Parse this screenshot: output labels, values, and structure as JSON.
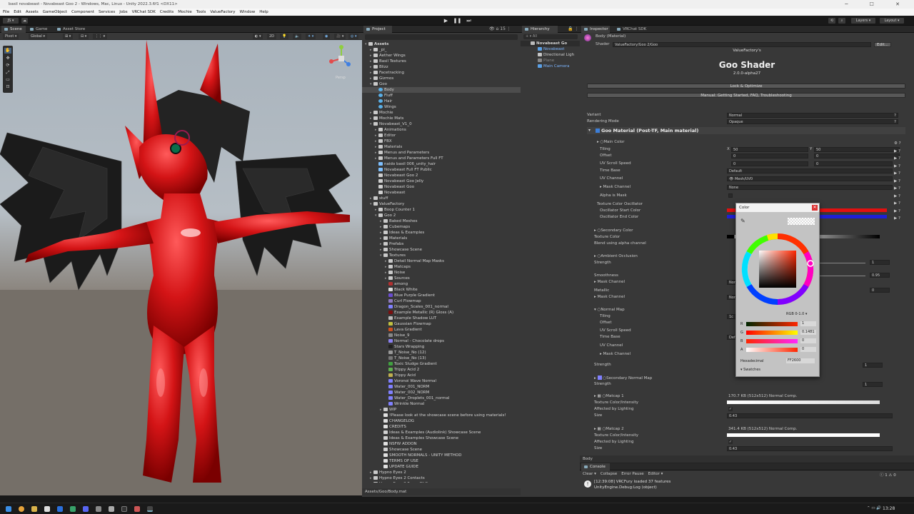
{
  "window": {
    "title": "basil novabeast - Novabeast Goo 2 - Windows, Mac, Linux - Unity 2022.3.6f1 <DX11>",
    "controls": "─ ☐ ✕"
  },
  "menu": [
    "File",
    "Edit",
    "Assets",
    "GameObject",
    "Component",
    "Services",
    "Jobs",
    "VRChat SDK",
    "Credits",
    "Mochie",
    "Tools",
    "ValueFactory",
    "Window",
    "Help"
  ],
  "toolbar": {
    "account": "JS",
    "layers": "Layers",
    "layout": "Layout"
  },
  "scene": {
    "tabs": [
      "Scene",
      "Game",
      "Asset Store"
    ],
    "pivot": "Pivot",
    "global": "Global",
    "mode2d": "2D",
    "gizmo_label": "Persp"
  },
  "project": {
    "tab": "Project",
    "root": "Assets",
    "search_count": "15",
    "footer": "Assets/Goo/Body.mat",
    "items": [
      {
        "t": "_pi_",
        "d": 1,
        "k": "folder"
      },
      {
        "t": "Aether Wings",
        "d": 1,
        "k": "folder"
      },
      {
        "t": "Basil Textures",
        "d": 1,
        "k": "folder"
      },
      {
        "t": "Blizz",
        "d": 1,
        "k": "folder"
      },
      {
        "t": "Facetracking",
        "d": 1,
        "k": "folder"
      },
      {
        "t": "Gizmos",
        "d": 1,
        "k": "folder"
      },
      {
        "t": "Goo",
        "d": 1,
        "k": "folder",
        "open": true
      },
      {
        "t": "Body",
        "d": 2,
        "k": "mat",
        "sel": true
      },
      {
        "t": "Fluff",
        "d": 2,
        "k": "mat"
      },
      {
        "t": "Hair",
        "d": 2,
        "k": "mat"
      },
      {
        "t": "Wings",
        "d": 2,
        "k": "mat"
      },
      {
        "t": "Mochie",
        "d": 1,
        "k": "folder"
      },
      {
        "t": "Mochie Mats",
        "d": 1,
        "k": "folder"
      },
      {
        "t": "Novabeast_V1_0",
        "d": 1,
        "k": "folder",
        "open": true
      },
      {
        "t": "Animations",
        "d": 2,
        "k": "folder"
      },
      {
        "t": "Editor",
        "d": 2,
        "k": "folder"
      },
      {
        "t": "FBX",
        "d": 2,
        "k": "folder"
      },
      {
        "t": "Materials",
        "d": 2,
        "k": "folder"
      },
      {
        "t": "Menus and Parameters",
        "d": 2,
        "k": "folder"
      },
      {
        "t": "Menus and Parameters Full FT",
        "d": 2,
        "k": "folder"
      },
      {
        "t": "naido basil 006_unity_hair",
        "d": 2,
        "k": "prefab"
      },
      {
        "t": "Novabeast Full FT Public",
        "d": 2,
        "k": "prefab"
      },
      {
        "t": "Novabeast Goo 2",
        "d": 2,
        "k": "scene"
      },
      {
        "t": "Novabeast Goo Jelly",
        "d": 2,
        "k": "scene"
      },
      {
        "t": "Novabeast Goo",
        "d": 2,
        "k": "scene"
      },
      {
        "t": "Novabeast",
        "d": 2,
        "k": "scene"
      },
      {
        "t": "stuff",
        "d": 1,
        "k": "folder"
      },
      {
        "t": "ValueFactory",
        "d": 1,
        "k": "folder",
        "open": true
      },
      {
        "t": "Boop Counter 1",
        "d": 2,
        "k": "folder"
      },
      {
        "t": "Goo 2",
        "d": 2,
        "k": "folder",
        "open": true
      },
      {
        "t": "Baked Meshes",
        "d": 3,
        "k": "folder"
      },
      {
        "t": "Cubemaps",
        "d": 3,
        "k": "folder"
      },
      {
        "t": "Ideas & Examples",
        "d": 3,
        "k": "folder"
      },
      {
        "t": "Materials",
        "d": 3,
        "k": "folder"
      },
      {
        "t": "Prefabs",
        "d": 3,
        "k": "folder"
      },
      {
        "t": "Showcase Scene",
        "d": 3,
        "k": "folder"
      },
      {
        "t": "Textures",
        "d": 3,
        "k": "folder",
        "open": true
      },
      {
        "t": "Detail Normal Map Masks",
        "d": 4,
        "k": "folder"
      },
      {
        "t": "Matcaps",
        "d": 4,
        "k": "folder"
      },
      {
        "t": "Noise",
        "d": 4,
        "k": "folder"
      },
      {
        "t": "Sources",
        "d": 4,
        "k": "folder"
      },
      {
        "t": "among",
        "d": 4,
        "k": "tex",
        "c": "#b03030"
      },
      {
        "t": "Black White",
        "d": 4,
        "k": "tex",
        "c": "#dddddd"
      },
      {
        "t": "Blue Purple Gradient",
        "d": 4,
        "k": "tex",
        "c": "#6a4cd0"
      },
      {
        "t": "Curl Flowmap",
        "d": 4,
        "k": "tex",
        "c": "#8f7ac0"
      },
      {
        "t": "Dragon_Scales_001_normal",
        "d": 4,
        "k": "tex",
        "c": "#8080ff"
      },
      {
        "t": "Example Metallic (R) Gloss (A)",
        "d": 4,
        "k": "tex",
        "c": "#7a1010"
      },
      {
        "t": "Example Shadow LUT",
        "d": 4,
        "k": "tex",
        "c": "#bbbbbb"
      },
      {
        "t": "Gaussian Flowmap",
        "d": 4,
        "k": "tex",
        "c": "#c0c040"
      },
      {
        "t": "Lava Gradient",
        "d": 4,
        "k": "tex",
        "c": "#d05020"
      },
      {
        "t": "Noise_9",
        "d": 4,
        "k": "tex",
        "c": "#888888"
      },
      {
        "t": "Normal - Chocolate drops",
        "d": 4,
        "k": "tex",
        "c": "#8a80f0"
      },
      {
        "t": "Stars Wrapping",
        "d": 4,
        "k": "tex",
        "c": "#202020"
      },
      {
        "t": "T_Noise_No (12)",
        "d": 4,
        "k": "tex",
        "c": "#999999"
      },
      {
        "t": "T_Noise_No (13)",
        "d": 4,
        "k": "tex",
        "c": "#777777"
      },
      {
        "t": "Toxic Sludge Gradient",
        "d": 4,
        "k": "tex",
        "c": "#40a040"
      },
      {
        "t": "Trippy Acid 2",
        "d": 4,
        "k": "tex",
        "c": "#60b050"
      },
      {
        "t": "Trippy Acid",
        "d": 4,
        "k": "tex",
        "c": "#c0b050"
      },
      {
        "t": "Voronoi Wave Normal",
        "d": 4,
        "k": "tex",
        "c": "#8080ff"
      },
      {
        "t": "Water_001_NORM",
        "d": 4,
        "k": "tex",
        "c": "#8080ff"
      },
      {
        "t": "Water_002_NORM",
        "d": 4,
        "k": "tex",
        "c": "#8080ff"
      },
      {
        "t": "Water_Droplets_001_normal",
        "d": 4,
        "k": "tex",
        "c": "#8080ff"
      },
      {
        "t": "Wrinkle Normal",
        "d": 4,
        "k": "tex",
        "c": "#8080ff"
      },
      {
        "t": "WIP",
        "d": 3,
        "k": "folder"
      },
      {
        "t": "!Please look at the showcase scene before using materials!",
        "d": 3,
        "k": "doc"
      },
      {
        "t": "CHANGELOG",
        "d": 3,
        "k": "doc"
      },
      {
        "t": "CREDITS",
        "d": 3,
        "k": "doc"
      },
      {
        "t": "Ideas & Examples (Audiolink) Showcase Scene",
        "d": 3,
        "k": "scene"
      },
      {
        "t": "Ideas & Examples Showcase Scene",
        "d": 3,
        "k": "scene"
      },
      {
        "t": "NSFW ADDON",
        "d": 3,
        "k": "doc"
      },
      {
        "t": "Showcase Scene",
        "d": 3,
        "k": "scene"
      },
      {
        "t": "SMOOTH NORMALS - UNITY METHOD",
        "d": 3,
        "k": "doc"
      },
      {
        "t": "TERMS OF USE",
        "d": 3,
        "k": "doc"
      },
      {
        "t": "UPDATE GUIDE",
        "d": 3,
        "k": "doc"
      },
      {
        "t": "Hypno Eyes 2",
        "d": 1,
        "k": "folder"
      },
      {
        "t": "Hypno Eyes 2 Contacts",
        "d": 1,
        "k": "folder"
      },
      {
        "t": "Hypno Eyes 2 Focus DLC",
        "d": 1,
        "k": "folder"
      }
    ]
  },
  "hierarchy": {
    "tab": "Hierarchy",
    "search": "All",
    "items": [
      "Novabeast Go",
      "Novabeast",
      "Directional Ligh",
      "Plane",
      "Main Camera"
    ]
  },
  "inspector": {
    "tabs": [
      "Inspector",
      "VRChat SDK"
    ],
    "material": "Body (Material)",
    "shader_label": "Shader",
    "shader": "ValueFactory/Goo 2/Goo",
    "edit": "Edit...",
    "brand": "ValueFactory's",
    "title": "Goo Shader",
    "version": "2.0.0-alpha27",
    "lock_btn": "Lock & Optimize",
    "manual_btn": "Manual: Getting Started, FAQ, Troubleshooting",
    "variant_label": "Variant",
    "variant": "Normal",
    "render_label": "Rendering Mode",
    "render": "Opaque",
    "main_section": "Goo Material (Post-TF, Main material)",
    "main_color": "Main Color",
    "tiling": "Tiling",
    "offset": "Offset",
    "uv_scroll": "UV Scroll Speed",
    "time_base": "Time Base",
    "uv_channel": "UV Channel",
    "mask_channel": "Mask Channel",
    "alpha_mask": "Alpha is Mask",
    "tcol_osc": "Texture Color Oscillator",
    "osc_start": "Oscillator Start Color",
    "osc_end": "Oscillator End Color",
    "secondary_color": "Secondary Color",
    "texture_color": "Texture Color",
    "blend_alpha": "Blend using alpha channel",
    "ambient": "Ambient Occlusion",
    "strength": "Strength",
    "smoothness": "Smoothness",
    "metallic": "Metallic",
    "normal_map": "Normal Map",
    "sec_normal": "Secondary Normal Map",
    "matcap1": "Matcap 1",
    "matcap2": "Matcap 2",
    "tex_intensity": "Texture Color/Intensity",
    "affected": "Affected by Lighting",
    "size": "Size",
    "footer": "Body",
    "v": {
      "x": "X",
      "y": "Y",
      "tile_x": "50",
      "tile_y": "50",
      "zero": "0",
      "default": "Default",
      "uv0": "Mesh/UV0",
      "none": "None",
      "norm_trunc": "Nor",
      "def_trunc": "Def",
      "one": "1",
      "smooth": "0.95",
      "tile_short": "1c",
      "mc1_info": "170.7 KB (512x512) Normal Comp.",
      "mc2_info": "341.4 KB (512x512) Normal Comp.",
      "size_val": "0.43"
    }
  },
  "color_picker": {
    "title": "Color",
    "mode": "RGB 0-1.0",
    "r_label": "R",
    "r": "1",
    "g_label": "G",
    "g": "0.1481",
    "b_label": "B",
    "b": "0",
    "a_label": "A",
    "a": "0",
    "hex_label": "Hexadecimal",
    "hex": "FF2600",
    "swatches": "Swatches"
  },
  "console": {
    "tab": "Console",
    "clear": "Clear",
    "collapse": "Collapse",
    "error_pause": "Error Pause",
    "editor": "Editor",
    "msg1": "[12:39:08] VRCFury loaded 37 features",
    "msg2": "UnityEngine.Debug:Log (object)",
    "count_warn": "1",
    "count_info": "0"
  },
  "taskbar": {
    "time": "13:28"
  },
  "colors": {
    "accent": "#3d7fd9",
    "picker_value": "#ff2600",
    "goo_red": "#d41416"
  }
}
